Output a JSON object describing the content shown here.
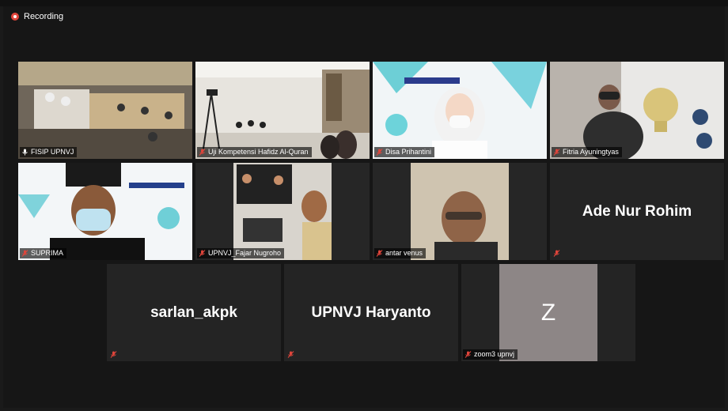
{
  "meeting": {
    "recording_label": "Recording",
    "colors": {
      "active_speaker_border": "#d6d23b",
      "recording": "#e0453b",
      "muted_mic": "#e0453b"
    }
  },
  "participants": [
    {
      "name": "FISIP UPNVJ",
      "muted": false,
      "video": true,
      "active": true
    },
    {
      "name": "Uji Kompetensi Hafidz Al-Quran",
      "muted": true,
      "video": true,
      "active": false
    },
    {
      "name": "Disa Prihantini",
      "muted": true,
      "video": true,
      "active": false
    },
    {
      "name": "Fitria Ayuningtyas",
      "muted": true,
      "video": true,
      "active": false
    },
    {
      "name": "SUPRIMA",
      "muted": true,
      "video": true,
      "active": false
    },
    {
      "name": "UPNVJ_Fajar Nugroho",
      "muted": true,
      "video": true,
      "active": false
    },
    {
      "name": "antar venus",
      "muted": true,
      "video": true,
      "active": false
    },
    {
      "name": "Ade Nur Rohim",
      "muted": true,
      "video": false,
      "active": false
    },
    {
      "name": "sarlan_akpk",
      "muted": true,
      "video": false,
      "active": false
    },
    {
      "name": "UPNVJ Haryanto",
      "muted": true,
      "video": false,
      "active": false
    },
    {
      "name": "zoom3 upnvj",
      "muted": true,
      "video": false,
      "active": false,
      "avatar_letter": "Z"
    }
  ]
}
